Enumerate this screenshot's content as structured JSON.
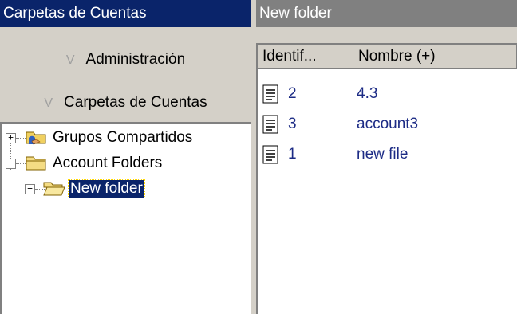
{
  "left_panel": {
    "title": "Carpetas de Cuentas",
    "nav": [
      {
        "chevron": "V",
        "label": "Administración"
      },
      {
        "chevron": "V",
        "label": "Carpetas de Cuentas"
      }
    ],
    "tree": [
      {
        "label": "Grupos Compartidos",
        "expander": "+",
        "icon": "shared-folder-icon"
      },
      {
        "label": "Account Folders",
        "expander": "−",
        "icon": "folder-icon"
      },
      {
        "label": "New folder",
        "expander": "−",
        "icon": "open-folder-icon",
        "selected": true
      }
    ]
  },
  "right_panel": {
    "title": "New folder",
    "columns": [
      "Identif...",
      "Nombre (+)"
    ],
    "rows": [
      {
        "id": "2",
        "name": "4.3",
        "icon": "document-icon"
      },
      {
        "id": "3",
        "name": "account3",
        "icon": "document-icon"
      },
      {
        "id": "1",
        "name": "new file",
        "icon": "document-icon"
      }
    ]
  },
  "colors": {
    "title_active": "#0a246a",
    "title_inactive": "#808080",
    "link_text": "#1c2b85"
  }
}
